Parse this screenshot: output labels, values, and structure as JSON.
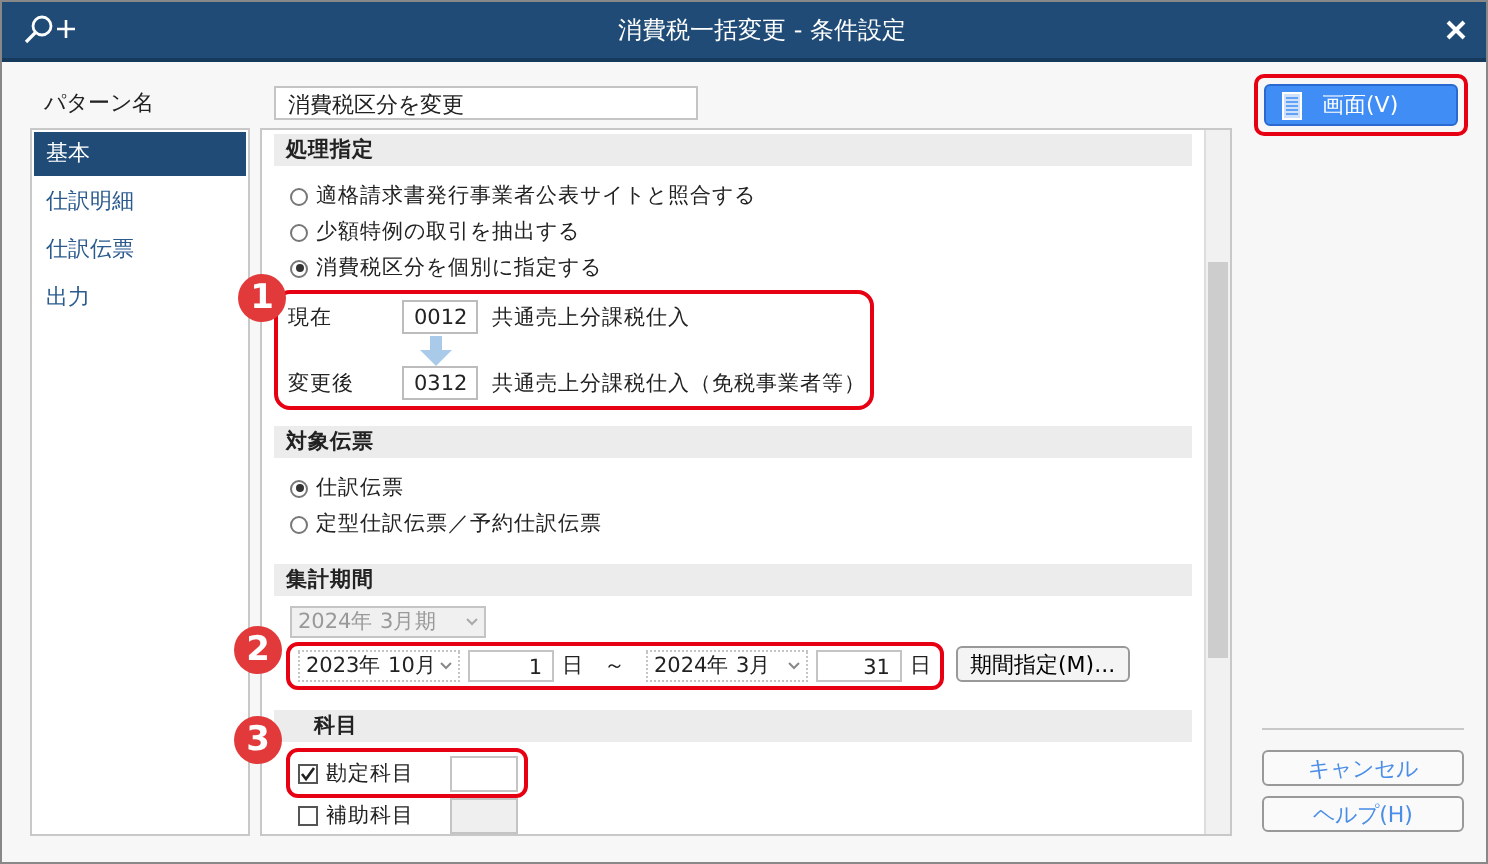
{
  "window": {
    "title": "消費税一括変更 - 条件設定"
  },
  "pattern": {
    "label": "パターン名",
    "value": "消費税区分を変更"
  },
  "sidebar": {
    "items": [
      {
        "label": "基本",
        "selected": true
      },
      {
        "label": "仕訳明細",
        "selected": false
      },
      {
        "label": "仕訳伝票",
        "selected": false
      },
      {
        "label": "出力",
        "selected": false
      }
    ]
  },
  "processing": {
    "title": "処理指定",
    "options": [
      {
        "label": "適格請求書発行事業者公表サイトと照合する",
        "selected": false
      },
      {
        "label": "少額特例の取引を抽出する",
        "selected": false
      },
      {
        "label": "消費税区分を個別に指定する",
        "selected": true
      }
    ],
    "callout": "1",
    "current": {
      "label": "現在",
      "code": "0012",
      "name": "共通売上分課税仕入"
    },
    "after": {
      "label": "変更後",
      "code": "0312",
      "name": "共通売上分課税仕入（免税事業者等）"
    }
  },
  "target": {
    "title": "対象伝票",
    "options": [
      {
        "label": "仕訳伝票",
        "selected": true
      },
      {
        "label": "定型仕訳伝票／予約仕訳伝票",
        "selected": false
      }
    ]
  },
  "period": {
    "title": "集計期間",
    "fiscal": {
      "value": "2024年  3月期",
      "disabled": true
    },
    "callout": "2",
    "from_month": "2023年 10月",
    "from_day": "1",
    "from_unit": "日",
    "separator": "～",
    "to_month": "2024年  3月",
    "to_day": "31",
    "to_unit": "日",
    "button": "期間指定(M)..."
  },
  "accounts": {
    "title": "科目",
    "callout": "3",
    "items": [
      {
        "label": "勘定科目",
        "checked": true
      },
      {
        "label": "補助科目",
        "checked": false
      }
    ]
  },
  "actions": {
    "view": "画面(V)",
    "cancel": "キャンセル",
    "help": "ヘルプ(H)"
  }
}
